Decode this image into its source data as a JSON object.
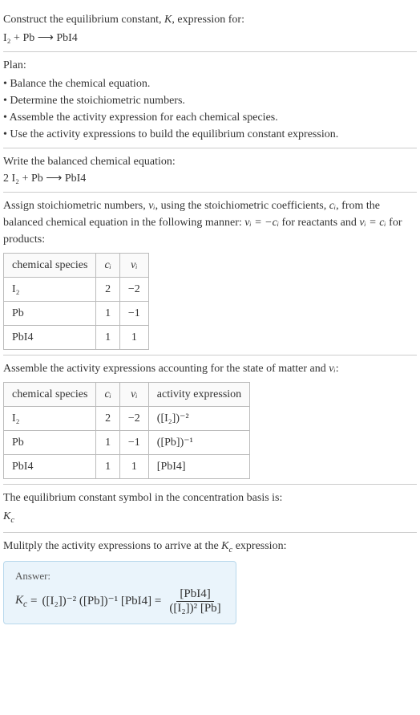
{
  "intro": {
    "title_pre": "Construct the equilibrium constant, ",
    "title_k": "K",
    "title_post": ", expression for:",
    "equation_lhs": "I₂ + Pb",
    "equation_arrow": "⟶",
    "equation_rhs": "PbI4"
  },
  "plan": {
    "heading": "Plan:",
    "items": [
      "• Balance the chemical equation.",
      "• Determine the stoichiometric numbers.",
      "• Assemble the activity expression for each chemical species.",
      "• Use the activity expressions to build the equilibrium constant expression."
    ]
  },
  "balanced": {
    "heading": "Write the balanced chemical equation:",
    "equation_lhs": "2 I₂ + Pb",
    "equation_arrow": "⟶",
    "equation_rhs": "PbI4"
  },
  "stoich": {
    "text_pre": "Assign stoichiometric numbers, ",
    "nu": "νᵢ",
    "text_mid1": ", using the stoichiometric coefficients, ",
    "ci": "cᵢ",
    "text_mid2": ", from the balanced chemical equation in the following manner: ",
    "rel_reactants": "νᵢ = −cᵢ",
    "text_mid3": " for reactants and ",
    "rel_products": "νᵢ = cᵢ",
    "text_post": " for products:",
    "headers": {
      "species": "chemical species",
      "ci": "cᵢ",
      "nu": "νᵢ"
    },
    "rows": [
      {
        "species": "I₂",
        "ci": "2",
        "nu": "−2"
      },
      {
        "species": "Pb",
        "ci": "1",
        "nu": "−1"
      },
      {
        "species": "PbI4",
        "ci": "1",
        "nu": "1"
      }
    ]
  },
  "activity": {
    "text_pre": "Assemble the activity expressions accounting for the state of matter and ",
    "nu": "νᵢ",
    "text_post": ":",
    "headers": {
      "species": "chemical species",
      "ci": "cᵢ",
      "nu": "νᵢ",
      "expr": "activity expression"
    },
    "rows": [
      {
        "species": "I₂",
        "ci": "2",
        "nu": "−2",
        "expr": "([I₂])⁻²"
      },
      {
        "species": "Pb",
        "ci": "1",
        "nu": "−1",
        "expr": "([Pb])⁻¹"
      },
      {
        "species": "PbI4",
        "ci": "1",
        "nu": "1",
        "expr": "[PbI4]"
      }
    ]
  },
  "symbol": {
    "text": "The equilibrium constant symbol in the concentration basis is:",
    "kc": "K_c"
  },
  "multiply": {
    "text_pre": "Mulitply the activity expressions to arrive at the ",
    "kc": "K_c",
    "text_post": " expression:"
  },
  "answer": {
    "label": "Answer:",
    "lhs": "K_c =",
    "mid": "([I₂])⁻² ([Pb])⁻¹ [PbI4] =",
    "frac_num": "[PbI4]",
    "frac_den": "([I₂])² [Pb]"
  }
}
